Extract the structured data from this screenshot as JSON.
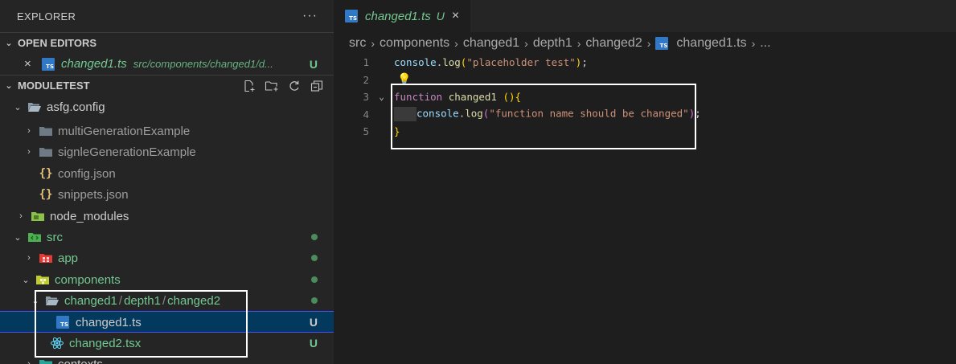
{
  "explorer": {
    "title": "EXPLORER",
    "more": "···"
  },
  "open_editors": {
    "header": "OPEN EDITORS",
    "item": {
      "close": "×",
      "badge": "TS",
      "name": "changed1.ts",
      "path": "src/components/changed1/d...",
      "status": "U"
    }
  },
  "workspace": {
    "header": "MODULETEST",
    "actions": [
      "new-file-icon",
      "new-folder-icon",
      "refresh-icon",
      "collapse-all-icon"
    ]
  },
  "tree": [
    {
      "name": "asfg.config",
      "chev": "⌄",
      "icon": "folder-open-icon",
      "color": "default"
    },
    {
      "name": "multiGenerationExample",
      "chev": "›",
      "icon": "folder-icon",
      "color": "muted"
    },
    {
      "name": "signleGenerationExample",
      "chev": "›",
      "icon": "folder-icon",
      "color": "muted"
    },
    {
      "name": "config.json",
      "chev": "",
      "icon": "json-icon",
      "color": "muted"
    },
    {
      "name": "snippets.json",
      "chev": "",
      "icon": "json-icon",
      "color": "muted"
    },
    {
      "name": "node_modules",
      "chev": "›",
      "icon": "node-folder-icon",
      "color": "default"
    },
    {
      "name": "src",
      "chev": "⌄",
      "icon": "src-folder-icon",
      "color": "green",
      "dot": true
    },
    {
      "name": "app",
      "chev": "›",
      "icon": "app-folder-icon",
      "color": "green",
      "dot": true
    },
    {
      "name": "components",
      "chev": "⌄",
      "icon": "components-folder-icon",
      "color": "green",
      "dot": true
    },
    {
      "name_parts": [
        "changed1",
        "depth1",
        "changed2"
      ],
      "chev": "⌄",
      "icon": "folder-open-icon",
      "color": "green",
      "dot": true
    },
    {
      "name": "changed1.ts",
      "icon": "ts-icon",
      "color": "default",
      "status": "U",
      "selected": true
    },
    {
      "name": "changed2.tsx",
      "icon": "react-icon",
      "color": "green",
      "status": "U"
    },
    {
      "name": "contexts",
      "chev": "›",
      "icon": "folder-icon",
      "color": "default"
    }
  ],
  "tab": {
    "badge": "TS",
    "name": "changed1.ts",
    "status": "U",
    "close": "×"
  },
  "breadcrumb": {
    "items": [
      "src",
      "components",
      "changed1",
      "depth1",
      "changed2"
    ],
    "badge": "TS",
    "file": "changed1.ts",
    "more": "..."
  },
  "code": {
    "line_numbers": [
      "1",
      "2",
      "3",
      "4",
      "5"
    ],
    "l1": {
      "obj": "console",
      "dot": ".",
      "fn": "log",
      "open": "(",
      "str": "\"placeholder test\"",
      "close": ")",
      "semi": ";"
    },
    "l3": {
      "kw": "function",
      "name": "changed1",
      "parens": " ()",
      "brace": "{"
    },
    "l4": {
      "obj": "console",
      "dot": ".",
      "fn": "log",
      "open": "(",
      "str": "\"function name should be changed\"",
      "close": ")",
      "semi": ";"
    },
    "l5": {
      "brace": "}"
    }
  },
  "colors": {
    "untracked_green": "#73c991",
    "ts_blue": "#3178c6",
    "selection": "#04395e",
    "highlight_box": "#ffffff"
  }
}
